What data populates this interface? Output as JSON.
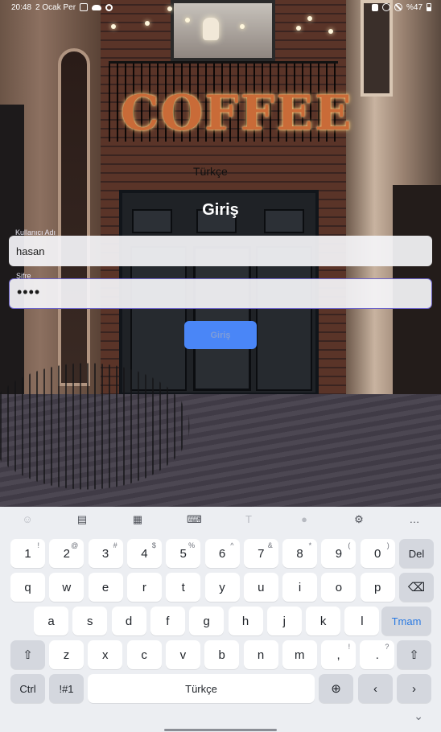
{
  "status_bar": {
    "time": "20:48",
    "date": "2 Ocak Per",
    "battery": "%47"
  },
  "background": {
    "sign_text": "COFFEE"
  },
  "login": {
    "language": "Türkçe",
    "title": "Giriş",
    "username_label": "Kullanıcı Adı",
    "username_value": "hasan",
    "password_label": "Şifre",
    "password_value": "••••",
    "submit_label": "Giriş"
  },
  "keyboard": {
    "toolbar_icons": [
      "emoji-icon",
      "clipboard-icon",
      "keyboard-mode-icon",
      "keyboard-layout-icon",
      "text-style-icon",
      "microphone-icon",
      "settings-icon",
      "more-icon"
    ],
    "row1": [
      {
        "label": "1",
        "hint": "!"
      },
      {
        "label": "2",
        "hint": "@"
      },
      {
        "label": "3",
        "hint": "#"
      },
      {
        "label": "4",
        "hint": "$"
      },
      {
        "label": "5",
        "hint": "%"
      },
      {
        "label": "6",
        "hint": "^"
      },
      {
        "label": "7",
        "hint": "&"
      },
      {
        "label": "8",
        "hint": "*"
      },
      {
        "label": "9",
        "hint": "("
      },
      {
        "label": "0",
        "hint": ")"
      }
    ],
    "del_label": "Del",
    "row2": [
      "q",
      "w",
      "e",
      "r",
      "t",
      "y",
      "u",
      "i",
      "o",
      "p"
    ],
    "row3": [
      "a",
      "s",
      "d",
      "f",
      "g",
      "h",
      "j",
      "k",
      "l"
    ],
    "enter_label": "Tmam",
    "row4": [
      "z",
      "x",
      "c",
      "v",
      "b",
      "n",
      "m"
    ],
    "comma": {
      "label": ",",
      "hint": "!"
    },
    "period": {
      "label": ".",
      "hint": "?"
    },
    "ctrl_label": "Ctrl",
    "symbols_label": "!#1",
    "space_label": "Türkçe"
  }
}
